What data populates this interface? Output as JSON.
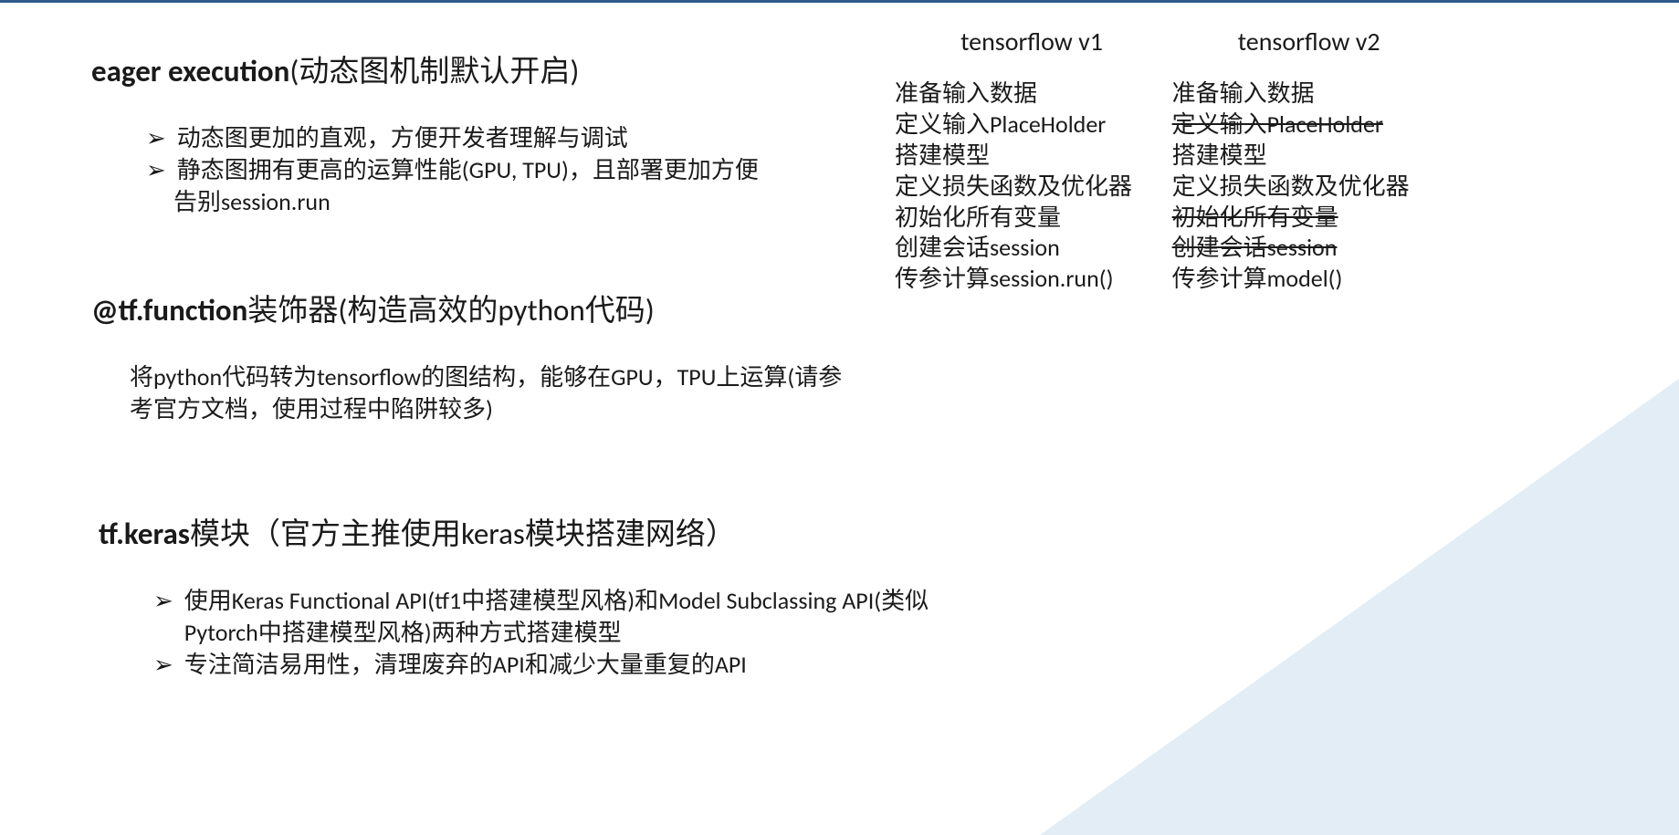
{
  "section1": {
    "title_bold": "eager execution",
    "title_rest": "(动态图机制默认开启)",
    "bullets": [
      "动态图更加的直观，方便开发者理解与调试",
      "静态图拥有更高的运算性能(GPU, TPU)，且部署更加方便"
    ],
    "bullets_extra": "告别session.run"
  },
  "section2": {
    "title_bold": "@tf.function",
    "title_rest": "装饰器(构造高效的python代码)",
    "paragraph": "将python代码转为tensorflow的图结构，能够在GPU，TPU上运算(请参考官方文档，使用过程中陷阱较多)"
  },
  "section3": {
    "title_bold": "tf.keras",
    "title_rest": "模块（官方主推使用keras模块搭建网络）",
    "bullets": [
      "使用Keras Functional API(tf1中搭建模型风格)和Model Subclassing API(类似Pytorch中搭建模型风格)两种方式搭建模型",
      "专注简洁易用性，清理废弃的API和减少大量重复的API"
    ]
  },
  "compare": {
    "col1": {
      "head": "tensorflow v1",
      "rows": [
        {
          "text": "准备输入数据",
          "strike": false
        },
        {
          "text": "定义输入PlaceHolder",
          "strike": false
        },
        {
          "text": "搭建模型",
          "strike": false
        },
        {
          "text": "定义损失函数及优化器",
          "strike": false
        },
        {
          "text": "初始化所有变量",
          "strike": false
        },
        {
          "text": "创建会话session",
          "strike": false
        },
        {
          "text": "传参计算session.run()",
          "strike": false
        }
      ]
    },
    "col2": {
      "head": "tensorflow v2",
      "rows": [
        {
          "text": "准备输入数据",
          "strike": false
        },
        {
          "text": "定义输入PlaceHolder",
          "strike": true
        },
        {
          "text": "搭建模型",
          "strike": false
        },
        {
          "text": "定义损失函数及优化器",
          "strike": false
        },
        {
          "text": "初始化所有变量",
          "strike": true
        },
        {
          "text": "创建会话session",
          "strike": true
        },
        {
          "text": "传参计算model()",
          "strike": false
        }
      ]
    }
  },
  "marker": "➢"
}
